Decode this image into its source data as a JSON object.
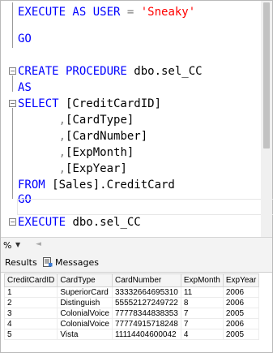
{
  "editor": {
    "line1": {
      "kw": "EXECUTE AS USER",
      "op": " = ",
      "str": "'Sneaky'"
    },
    "line2": {
      "kw": "GO"
    },
    "line3": {
      "kw": "CREATE PROCEDURE",
      "rest": " dbo.sel_CC"
    },
    "line4": {
      "kw": "AS"
    },
    "line5": {
      "kw": "SELECT",
      "rest": " [CreditCardID]"
    },
    "line6": {
      "comma": "      ,",
      "rest": "[CardType]"
    },
    "line7": {
      "comma": "      ,",
      "rest": "[CardNumber]"
    },
    "line8": {
      "comma": "      ,",
      "rest": "[ExpMonth]"
    },
    "line9": {
      "comma": "      ,",
      "rest": "[ExpYear]"
    },
    "line10": {
      "kw": "FROM",
      "rest": " [Sales].CreditCard"
    },
    "line11": {
      "kw": "GO"
    },
    "line12": {
      "kw": "EXECUTE",
      "rest": " dbo.sel_CC"
    }
  },
  "statusbar": {
    "zoom": "%",
    "zoom_dropdown": "▼",
    "scroll_left": "◄"
  },
  "tabs": {
    "results": "Results",
    "messages": "Messages"
  },
  "results": {
    "columns": [
      "CreditCardID",
      "CardType",
      "CardNumber",
      "ExpMonth",
      "ExpYear"
    ],
    "rows": [
      [
        "1",
        "SuperiorCard",
        "33332664695310",
        "11",
        "2006"
      ],
      [
        "2",
        "Distinguish",
        "55552127249722",
        "8",
        "2006"
      ],
      [
        "3",
        "ColonialVoice",
        "77778344838353",
        "7",
        "2005"
      ],
      [
        "4",
        "ColonialVoice",
        "77774915718248",
        "7",
        "2006"
      ],
      [
        "5",
        "Vista",
        "11114404600042",
        "4",
        "2005"
      ]
    ]
  }
}
